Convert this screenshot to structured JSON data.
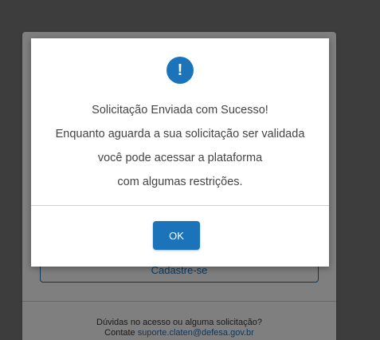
{
  "background": {
    "register_button": "Cadastre-se",
    "help_line1": "Dúvidas no acesso ou alguma solicitação?",
    "help_contact_prefix": "Contate ",
    "help_contact_email": "suporte.claten@defesa.gov.br"
  },
  "modal": {
    "icon": "exclamation-icon",
    "lines": [
      "Solicitação Enviada com Sucesso!",
      "Enquanto aguarda a sua solicitação ser validada",
      "você pode acessar a plataforma",
      "com algumas restrições."
    ],
    "ok_label": "OK"
  },
  "colors": {
    "accent": "#1b73ba",
    "text": "#444444",
    "overlay": "#7a7a7a"
  }
}
